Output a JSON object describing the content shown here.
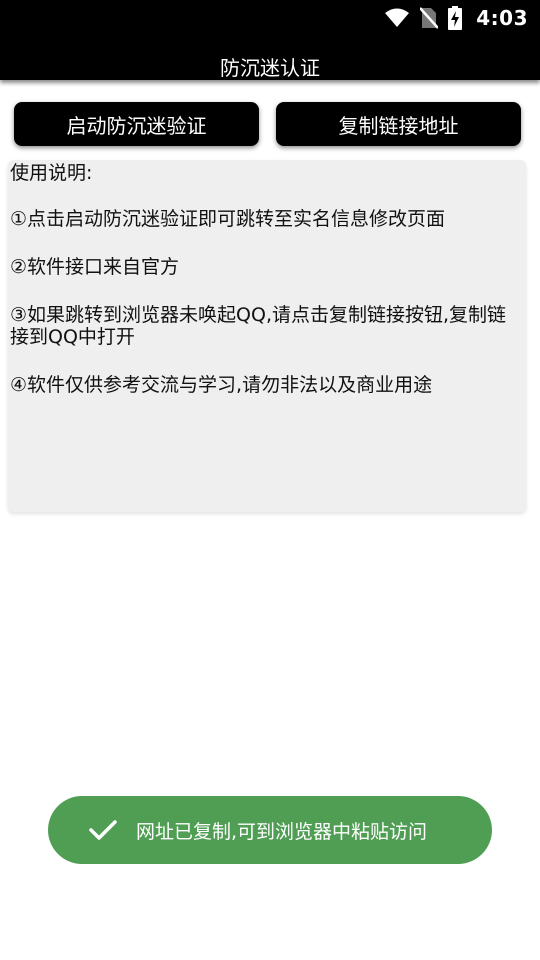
{
  "status_bar": {
    "time": "4:03",
    "icons": [
      "wifi-icon",
      "no-sim-icon",
      "battery-charging-icon"
    ]
  },
  "app": {
    "title": "防沉迷认证"
  },
  "buttons": {
    "start_verify": "启动防沉迷验证",
    "copy_link": "复制链接地址"
  },
  "instructions": {
    "heading": "使用说明:",
    "items": [
      " ①点击启动防沉迷验证即可跳转至实名信息修改页面",
      " ②软件接口来自官方",
      " ③如果跳转到浏览器未唤起QQ,请点击复制链接按钮,复制链接到QQ中打开",
      " ④软件仅供参考交流与学习,请勿非法以及商业用途"
    ]
  },
  "toast": {
    "icon": "check-icon",
    "message": "网址已复制,可到浏览器中粘贴访问",
    "color": "#4f9e54"
  }
}
